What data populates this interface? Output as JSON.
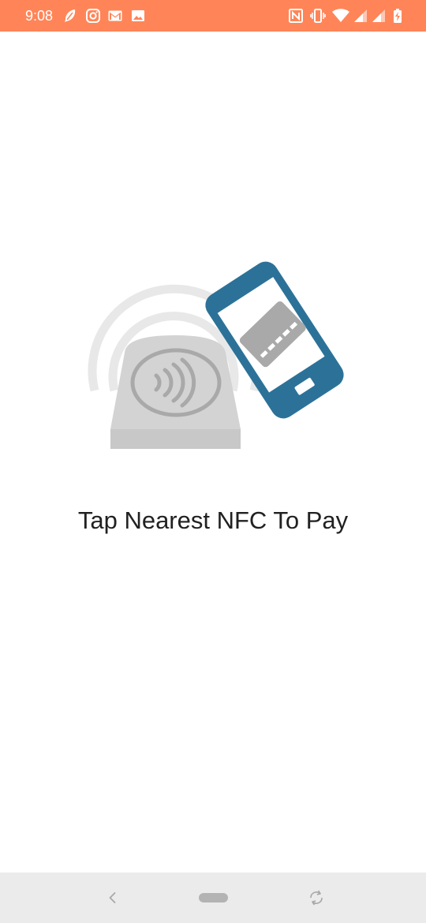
{
  "status_bar": {
    "time": "9:08",
    "background_color": "#FF8558",
    "left_icons": [
      "feather-icon",
      "instagram-icon",
      "gmail-icon",
      "image-icon"
    ],
    "right_icons": [
      "nfc-icon",
      "vibrate-icon",
      "wifi-icon",
      "signal-icon",
      "signal-icon",
      "battery-charging-icon"
    ]
  },
  "main": {
    "illustration": "nfc-payment-illustration",
    "prompt_text": "Tap Nearest NFC To Pay"
  },
  "colors": {
    "phone_blue": "#2C7298",
    "terminal_gray": "#D3D3D3",
    "card_gray": "#A9A9A9",
    "wave_gray": "#E8E8E8"
  },
  "nav_bar": {
    "buttons": [
      "back-icon",
      "home-pill",
      "rotate-icon"
    ]
  }
}
